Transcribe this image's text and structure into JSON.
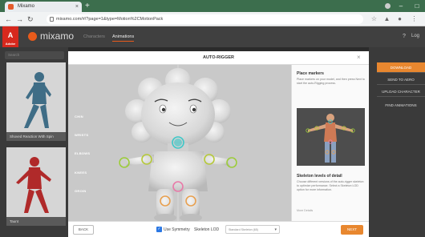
{
  "browser": {
    "tab_title": "Mixamo",
    "new_tab_glyph": "+",
    "close_tab_glyph": "×",
    "url": "mixamo.com/#/?page=1&type=Motion%2CMotionPack",
    "window_controls": [
      "–",
      "□",
      "×"
    ],
    "icons": [
      "back-icon",
      "forward-icon",
      "reload-icon",
      "star-icon",
      "extensions-icon",
      "profile-icon",
      "menu-icon"
    ]
  },
  "app": {
    "brand_badge": "A",
    "brand_badge_sub": "Adobe",
    "name": "mixamo",
    "nav": [
      "Characters",
      "Animations"
    ],
    "active_nav": "Animations",
    "help_glyph": "?",
    "user_label": "Log"
  },
  "library": {
    "search_placeholder": "Search",
    "cards": [
      {
        "caption": "Shoved Reaction With Spin",
        "figure_color": "#3f6d86"
      },
      {
        "caption": "Taunt",
        "figure_color": "#b02a2a"
      }
    ]
  },
  "right_panel": {
    "buttons": [
      "DOWNLOAD",
      "SEND TO AERO",
      "UPLOAD CHARACTER"
    ],
    "link": "FIND ANIMATIONS"
  },
  "modal": {
    "title": "AUTO-RIGGER",
    "close_glyph": "×",
    "joint_labels": [
      "CHIN",
      "WRISTS",
      "ELBOWS",
      "KNEES",
      "GROIN"
    ],
    "marker_colors": {
      "chin": "#3bc8c8",
      "wrists": "#9ccc3a",
      "elbows": "#b6c93a",
      "knees": "#e8a050",
      "groin": "#e87aa8"
    },
    "side": {
      "place_markers_heading": "Place markers",
      "place_markers_text": "Place markers on your model, and then press Next to start the auto-Rigging process.",
      "lod_heading": "Skeleton levels of detail",
      "lod_text": "Choose different versions of the auto-rigger skeleton to optimize performance. Select a Skeleton LOD option for more information.",
      "learn_more": "More Details"
    },
    "footer": {
      "back": "BACK",
      "symmetry_label": "Use Symmetry",
      "symmetry_checked": true,
      "lod_label": "Skeleton LOD",
      "lod_value": "Standard Skeleton (65)",
      "next": "NEXT"
    }
  }
}
